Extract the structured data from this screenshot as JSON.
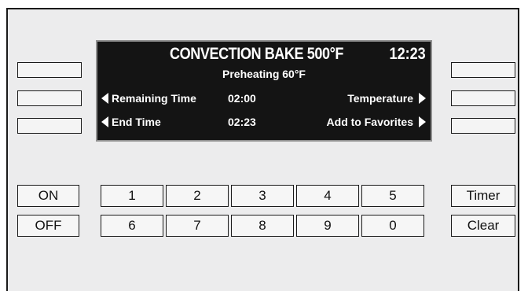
{
  "display": {
    "mode_title": "CONVECTION BAKE 500°F",
    "clock": "12:23",
    "status": "Preheating 60°F",
    "rows": [
      {
        "left_label": "Remaining Time",
        "value": "02:00",
        "right_label": "Temperature"
      },
      {
        "left_label": "End Time",
        "value": "02:23",
        "right_label": "Add to Favorites"
      }
    ]
  },
  "power": {
    "on_label": "ON",
    "off_label": "OFF"
  },
  "keypad": {
    "row1": [
      "1",
      "2",
      "3",
      "4",
      "5"
    ],
    "row2": [
      "6",
      "7",
      "8",
      "9",
      "0"
    ]
  },
  "functions": {
    "timer_label": "Timer",
    "clear_label": "Clear"
  },
  "colors": {
    "panel": "#ececed",
    "screen": "#141414",
    "screen_text": "#ffffff",
    "key_border": "#1a1a1a"
  }
}
